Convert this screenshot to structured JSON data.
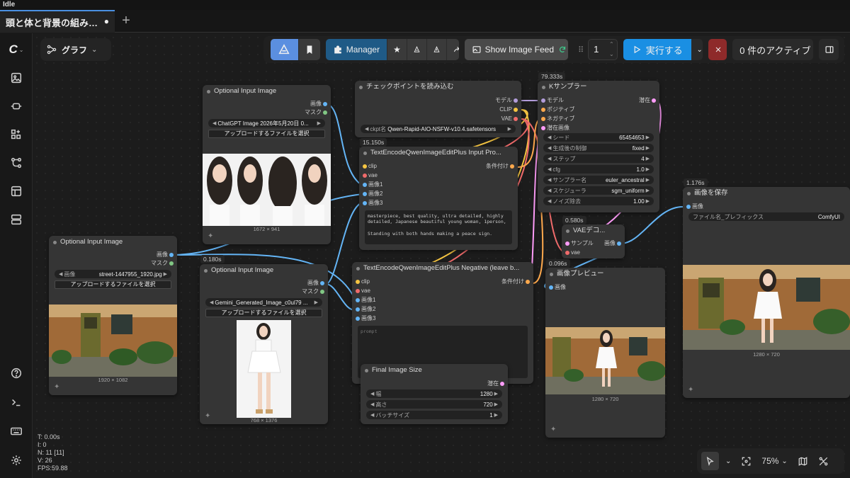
{
  "window": {
    "status": "Idle"
  },
  "tabs": [
    {
      "label": "頭と体と背景の組み…",
      "modified_dot": "●"
    }
  ],
  "tab_add": "+",
  "graph_menu": {
    "label": "グラフ"
  },
  "toolbar": {
    "manager_label": "Manager",
    "show_feed_label": "Show Image Feed",
    "queue_count": "1",
    "run_label": "実行する",
    "active_label": "0 件のアクティブ"
  },
  "nodes": {
    "input1": {
      "title": "Optional Input Image",
      "outputs": [
        "画像",
        "マスク"
      ],
      "file_label": "画像",
      "file_value": "street-1447955_1920.jpg",
      "upload_label": "アップロードするファイルを選択",
      "size": "1920 × 1082"
    },
    "input2": {
      "title": "Optional Input Image",
      "outputs": [
        "画像",
        "マスク"
      ],
      "file_value": "ChatGPT Image 2026年5月20日 0...",
      "upload_label": "アップロードするファイルを選択",
      "size": "1672 × 941"
    },
    "input3": {
      "time": "0.180s",
      "title": "Optional Input Image",
      "outputs": [
        "画像",
        "マスク"
      ],
      "file_value": "Gemini_Generated_Image_c0ul79 ...",
      "upload_label": "アップロードするファイルを選択",
      "size": "768 × 1376"
    },
    "checkpoint": {
      "title": "チェックポイントを読み込む",
      "outputs": [
        "モデル",
        "CLIP",
        "VAE"
      ],
      "ckpt_label": "ckpt名",
      "ckpt_value": "Qwen-Rapid-AIO-NSFW-v10.4.safetensors"
    },
    "encode_pos": {
      "time": "15.150s",
      "title": "TextEncodeQwenImageEditPlus Input Pro...",
      "inputs": [
        "clip",
        "vae",
        "画像1",
        "画像2",
        "画像3"
      ],
      "output": "条件付け",
      "prompt": "masterpiece, best quality, ultra detailed, highly detailed, Japanese beautiful young woman, 1person,\n\nStanding with both hands making a peace sign."
    },
    "encode_neg": {
      "title": "TextEncodeQwenImageEditPlus Negative (leave b...",
      "inputs": [
        "clip",
        "vae",
        "画像1",
        "画像2",
        "画像3"
      ],
      "output": "条件付け",
      "prompt_placeholder": "prompt"
    },
    "ksampler": {
      "time": "79.333s",
      "title": "Kサンプラー",
      "inputs": [
        "モデル",
        "ポジティブ",
        "ネガティブ",
        "潜在画像"
      ],
      "output": "潜在",
      "widgets": [
        {
          "label": "シード",
          "value": "65454653"
        },
        {
          "label": "生成後の制御",
          "value": "fixed"
        },
        {
          "label": "ステップ",
          "value": "4"
        },
        {
          "label": "cfg",
          "value": "1.0"
        },
        {
          "label": "サンプラー名",
          "value": "euler_ancestral"
        },
        {
          "label": "スケジューラ",
          "value": "sgm_uniform"
        },
        {
          "label": "ノイズ除去",
          "value": "1.00"
        }
      ]
    },
    "vae_decode": {
      "time": "0.580s",
      "title": "VAEデコ...",
      "inputs": [
        "サンプル",
        "vae"
      ],
      "output": "画像"
    },
    "preview": {
      "time": "0.096s",
      "title": "画像プレビュー",
      "input": "画像",
      "size": "1280 × 720"
    },
    "save": {
      "time": "1.176s",
      "title": "画像を保存",
      "input": "画像",
      "prefix_label": "ファイル名_プレフィックス",
      "prefix_value": "ComfyUI",
      "size": "1280 × 720"
    },
    "final_size": {
      "title": "Final Image Size",
      "output": "潜在",
      "widgets": [
        {
          "label": "幅",
          "value": "1280"
        },
        {
          "label": "高さ",
          "value": "720"
        },
        {
          "label": "バッチサイズ",
          "value": "1"
        }
      ]
    }
  },
  "stats": {
    "t": "T: 0.00s",
    "i": "I: 0",
    "n": "N: 11 [11]",
    "v": "V: 26",
    "fps": "FPS:59.88"
  },
  "zoom": {
    "level": "75%"
  },
  "colors": {
    "accent": "#1a8fe3",
    "clip": "#f5c542",
    "vae": "#f06b6b",
    "image": "#64b5f6",
    "model": "#b39ddb",
    "conditioning": "#ffa94d",
    "latent": "#ff9cf9",
    "stop": "#c0392b"
  }
}
